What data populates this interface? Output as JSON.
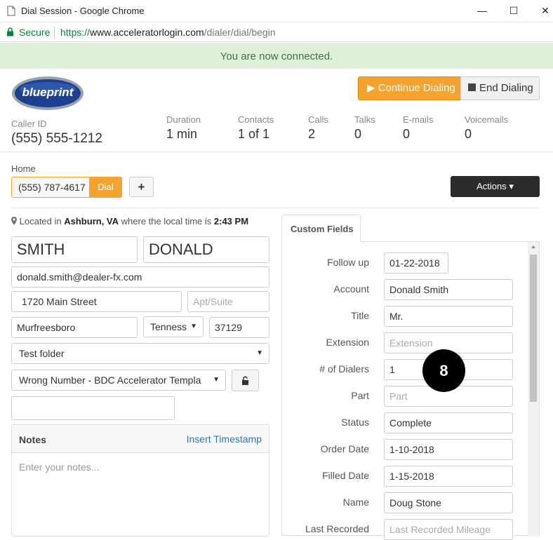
{
  "window": {
    "title": "Dial Session - Google Chrome",
    "minimize_glyph": "—",
    "maximize_glyph": "☐",
    "close_glyph": "✕"
  },
  "address_bar": {
    "secure_label": "Secure",
    "url_scheme": "https://",
    "url_host": "www.acceleratorlogin.com",
    "url_path": "/dialer/dial/begin"
  },
  "banner": {
    "text": "You are now connected."
  },
  "header": {
    "logo_text": "blueprint",
    "continue_label": "Continue Dialing",
    "end_label": "End Dialing"
  },
  "stats": {
    "caller_id": {
      "label": "Caller ID",
      "value": "(555) 555-1212"
    },
    "duration": {
      "label": "Duration",
      "value": "1 min"
    },
    "contacts": {
      "label": "Contacts",
      "value": "1 of 1"
    },
    "calls": {
      "label": "Calls",
      "value": "2"
    },
    "talks": {
      "label": "Talks",
      "value": "0"
    },
    "emails": {
      "label": "E-mails",
      "value": "0"
    },
    "voicemails": {
      "label": "Voicemails",
      "value": "0"
    }
  },
  "phone": {
    "type_label": "Home",
    "number": "(555) 787-4617",
    "dial_label": "Dial",
    "add_label": "+",
    "actions_label": "Actions ▾"
  },
  "contact": {
    "location_prefix": "Located in",
    "location_city": "Ashburn, VA",
    "location_mid": "where the local time is",
    "local_time": "2:43 PM",
    "last_name": "SMITH",
    "first_name": "DONALD",
    "email": "donald.smith@dealer-fx.com",
    "address": "1720 Main Street",
    "apt_placeholder": "Apt/Suite",
    "city": "Murfreesboro",
    "state": "Tenness",
    "zip": "37129",
    "folder": "Test folder",
    "disposition": "Wrong Number - BDC Accelerator Templa",
    "extra_field": ""
  },
  "notes": {
    "title": "Notes",
    "insert_timestamp": "Insert Timestamp",
    "placeholder": "Enter your notes..."
  },
  "custom_fields": {
    "tab_label": "Custom Fields",
    "rows": [
      {
        "label": "Follow up",
        "value": "01-22-2018",
        "placeholder": ""
      },
      {
        "label": "Account",
        "value": "Donald Smith",
        "placeholder": ""
      },
      {
        "label": "Title",
        "value": "Mr.",
        "placeholder": ""
      },
      {
        "label": "Extension",
        "value": "",
        "placeholder": "Extension"
      },
      {
        "label": "# of Dialers",
        "value": "1",
        "placeholder": ""
      },
      {
        "label": "Part",
        "value": "",
        "placeholder": "Part"
      },
      {
        "label": "Status",
        "value": "Complete",
        "placeholder": ""
      },
      {
        "label": "Order Date",
        "value": "1-10-2018",
        "placeholder": ""
      },
      {
        "label": "Filled Date",
        "value": "1-15-2018",
        "placeholder": ""
      },
      {
        "label": "Name",
        "value": "Doug Stone",
        "placeholder": ""
      },
      {
        "label": "Last Recorded",
        "value": "",
        "placeholder": "Last Recorded Mileage"
      }
    ]
  },
  "overlay_badge": "8",
  "colors": {
    "accent_orange": "#f6a22f",
    "success_bg": "#dff0d8",
    "success_text": "#3c763d",
    "link_blue": "#2a7ab8",
    "secure_green": "#0b8043"
  }
}
